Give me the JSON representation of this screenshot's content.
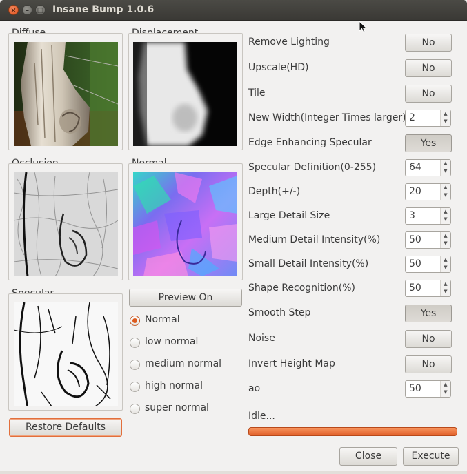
{
  "window": {
    "title": "Insane Bump 1.0.6",
    "close_glyph": "×",
    "min_glyph": "–",
    "max_glyph": "□"
  },
  "panels": {
    "diffuse": "Diffuse",
    "displacement": "Displacement",
    "occlusion": "Occlusion",
    "normal": "Normal",
    "specular": "Specular"
  },
  "preview_button": "Preview On",
  "restore_button": "Restore Defaults",
  "normal_modes": [
    {
      "label": "Normal",
      "selected": true
    },
    {
      "label": "low normal",
      "selected": false
    },
    {
      "label": "medium normal",
      "selected": false
    },
    {
      "label": "high normal",
      "selected": false
    },
    {
      "label": "super normal",
      "selected": false
    }
  ],
  "settings": {
    "remove_lighting": {
      "label": "Remove Lighting",
      "value": "No"
    },
    "upscale": {
      "label": "Upscale(HD)",
      "value": "No"
    },
    "tile": {
      "label": "Tile",
      "value": "No"
    },
    "new_width": {
      "label": "New Width(Integer Times larger)",
      "value": "2"
    },
    "edge_specular": {
      "label": "Edge Enhancing Specular",
      "value": "Yes"
    },
    "specular_definition": {
      "label": "Specular Definition(0-255)",
      "value": "64"
    },
    "depth": {
      "label": "Depth(+/-)",
      "value": "20"
    },
    "large_detail": {
      "label": "Large Detail Size",
      "value": "3"
    },
    "medium_detail": {
      "label": "Medium Detail Intensity(%)",
      "value": "50"
    },
    "small_detail": {
      "label": "Small Detail Intensity(%)",
      "value": "50"
    },
    "shape_recognition": {
      "label": "Shape Recognition(%)",
      "value": "50"
    },
    "smooth_step": {
      "label": "Smooth Step",
      "value": "Yes"
    },
    "noise": {
      "label": "Noise",
      "value": "No"
    },
    "invert_height": {
      "label": "Invert Height Map",
      "value": "No"
    },
    "ao": {
      "label": "ao",
      "value": "50"
    }
  },
  "status": "Idle...",
  "progress": 1.0,
  "close_button": "Close",
  "execute_button": "Execute",
  "colors": {
    "accent": "#e1612a",
    "window_bg": "#f2f1f0",
    "titlebar": "#3c3b37"
  }
}
